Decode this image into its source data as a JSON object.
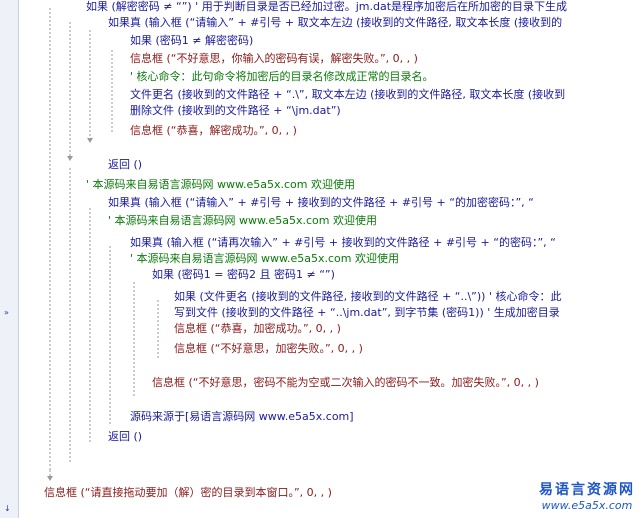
{
  "gutter": {
    "arrow_mid": "»",
    "arrow_bottom": "↓"
  },
  "code": [
    {
      "ind": 1,
      "color": "kw",
      "text": "如果 (解密密码 ≠ “”)  ' 用于判断目录是否已经加过密。jm.dat是程序加密后在所加密的目录下生成"
    },
    {
      "ind": 2,
      "color": "kw",
      "text": "如果真 (输入框 (“请输入” + #引号 + 取文本左边 (接收到的文件路径, 取文本长度 (接收到的"
    },
    {
      "ind": 3,
      "color": "kw",
      "text": "如果 (密码1 ≠ 解密密码)"
    },
    {
      "ind": 3,
      "color": "fn",
      "text": "信息框 (“不好意思，你输入的密码有误，解密失败。”, 0, , )"
    },
    {
      "ind": 3,
      "color": "cmt",
      "text": "' 核心命令：此句命令将加密后的目录名修改成正常的目录名。"
    },
    {
      "ind": 3,
      "color": "kw",
      "text": "文件更名 (接收到的文件路径 + “.\\”, 取文本左边 (接收到的文件路径, 取文本长度 (接收到"
    },
    {
      "ind": 3,
      "color": "kw",
      "text": "删除文件 (接收到的文件路径 + “\\jm.dat”)"
    },
    {
      "ind": 3,
      "color": "fn",
      "text": "信息框 (“恭喜，解密成功。”, 0, , )"
    },
    {
      "ind": 2,
      "color": "kw",
      "text": "返回 ()"
    },
    {
      "ind": 1,
      "color": "cmt",
      "text": "' 本源码来自易语言源码网 www.e5a5x.com  欢迎使用"
    },
    {
      "ind": 2,
      "color": "kw",
      "text": "如果真 (输入框 (“请输入” + #引号 + 接收到的文件路径 + #引号 + “的加密密码：”, “"
    },
    {
      "ind": 2,
      "color": "cmt",
      "text": "' 本源码来自易语言源码网 www.e5a5x.com  欢迎使用"
    },
    {
      "ind": 3,
      "color": "kw",
      "text": "如果真 (输入框 (“请再次输入” + #引号 + 接收到的文件路径 + #引号 + “的密码：”, “"
    },
    {
      "ind": 3,
      "color": "cmt",
      "text": "' 本源码来自易语言源码网 www.e5a5x.com  欢迎使用"
    },
    {
      "ind": 4,
      "color": "kw",
      "text": "如果 (密码1 = 密码2 且 密码1 ≠ “”)"
    },
    {
      "ind": 5,
      "color": "kw",
      "text": "如果 (文件更名 (接收到的文件路径, 接收到的文件路径 + “..\\”))  ' 核心命令：此"
    },
    {
      "ind": 5,
      "color": "kw",
      "text": "写到文件 (接收到的文件路径 + “..\\jm.dat”, 到字节集 (密码1))  ' 生成加密目录"
    },
    {
      "ind": 5,
      "color": "fn",
      "text": "信息框 (“恭喜，加密成功。”, 0, , )"
    },
    {
      "ind": 5,
      "color": "fn",
      "text": "信息框 (“不好意思，加密失败。”, 0, , )"
    },
    {
      "ind": 4,
      "color": "fn",
      "text": "信息框 (“不好意思，密码不能为空或二次输入的密码不一致。加密失败。”, 0, , )"
    },
    {
      "ind": 3,
      "color": "kw",
      "text": "源码来源于[易语言源码网 www.e5a5x.com]"
    },
    {
      "ind": 2,
      "color": "kw",
      "text": "返回 ()"
    },
    {
      "ind": 0,
      "color": "fn",
      "text": "信息框 (“请直接拖动要加（解）密的目录到本窗口。”, 0, , )"
    }
  ],
  "watermark": {
    "title": "易语言资源网",
    "url": "www.e5a5x.com"
  }
}
